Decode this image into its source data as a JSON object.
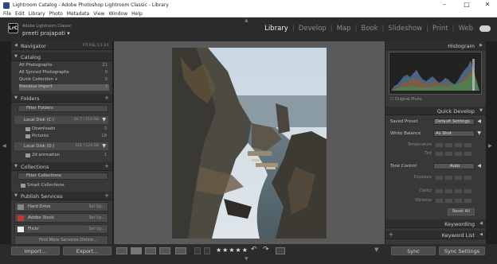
{
  "window": {
    "title": "Lightroom Catalog - Adobe Photoshop Lightroom Classic - Library",
    "controls": [
      "–",
      "□",
      "✕"
    ]
  },
  "menu": [
    "File",
    "Edit",
    "Library",
    "Photo",
    "Metadata",
    "View",
    "Window",
    "Help"
  ],
  "identity": {
    "badge": "LrC",
    "product": "Adobe Lightroom Classic",
    "user": "preeti prajapati"
  },
  "modules": [
    "Library",
    "Develop",
    "Map",
    "Book",
    "Slideshow",
    "Print",
    "Web"
  ],
  "active_module": "Library",
  "left": {
    "navigator": {
      "title": "Navigator",
      "zoom": "FIT  FILL  1:1  3:1"
    },
    "catalog": {
      "title": "Catalog",
      "items": [
        {
          "label": "All Photographs",
          "count": "21"
        },
        {
          "label": "All Synced Photographs",
          "count": "0"
        },
        {
          "label": "Quick Collection +",
          "count": "0"
        },
        {
          "label": "Previous Import",
          "count": "3"
        }
      ]
    },
    "folders": {
      "title": "Folders",
      "filter": "Filter Folders",
      "disk_c": {
        "label": "Local Disk (C:)",
        "usage": "44.7 / 114 GB"
      },
      "c_folders": [
        {
          "label": "Downloads",
          "count": "3"
        },
        {
          "label": "Pictures",
          "count": "18"
        }
      ],
      "disk_d": {
        "label": "Local Disk (D:)",
        "usage": "121 / 124 GB"
      },
      "d_folders": [
        {
          "label": "2d animation",
          "count": "1"
        }
      ]
    },
    "collections": {
      "title": "Collections",
      "filter": "Filter Collections",
      "smart": "Smart Collections"
    },
    "publish": {
      "title": "Publish Services",
      "services": [
        {
          "label": "Hard Drive",
          "action": "Set Up..."
        },
        {
          "label": "Adobe Stock",
          "action": "Set Up..."
        },
        {
          "label": "Flickr",
          "action": "Set Up..."
        }
      ],
      "find_more": "Find More Services Online..."
    },
    "import_label": "Import...",
    "export_label": "Export..."
  },
  "right": {
    "histogram": {
      "title": "Histogram",
      "original": "Original Photo"
    },
    "quick_develop": {
      "title": "Quick Develop",
      "saved_preset": {
        "label": "Saved Preset",
        "value": "Default Settings"
      },
      "white_balance": {
        "label": "White Balance",
        "value": "As Shot"
      },
      "wb_rows": [
        "Temperature",
        "Tint"
      ],
      "tone_control": {
        "label": "Tone Control",
        "value": "Auto"
      },
      "tone_rows": [
        "Exposure",
        "Clarity",
        "Vibrance"
      ],
      "reset_all": "Reset All"
    },
    "keywording": "Keywording",
    "keyword_list": "Keyword List",
    "sync_label": "Sync",
    "sync_settings_label": "Sync Settings"
  },
  "toolbar": {
    "stars": "★★★★★"
  },
  "colors": {
    "panel_bg": "#383838",
    "center_bg": "#5a5a5a",
    "header_bg": "#2b2b2b",
    "selected": "#5b5b5b"
  }
}
